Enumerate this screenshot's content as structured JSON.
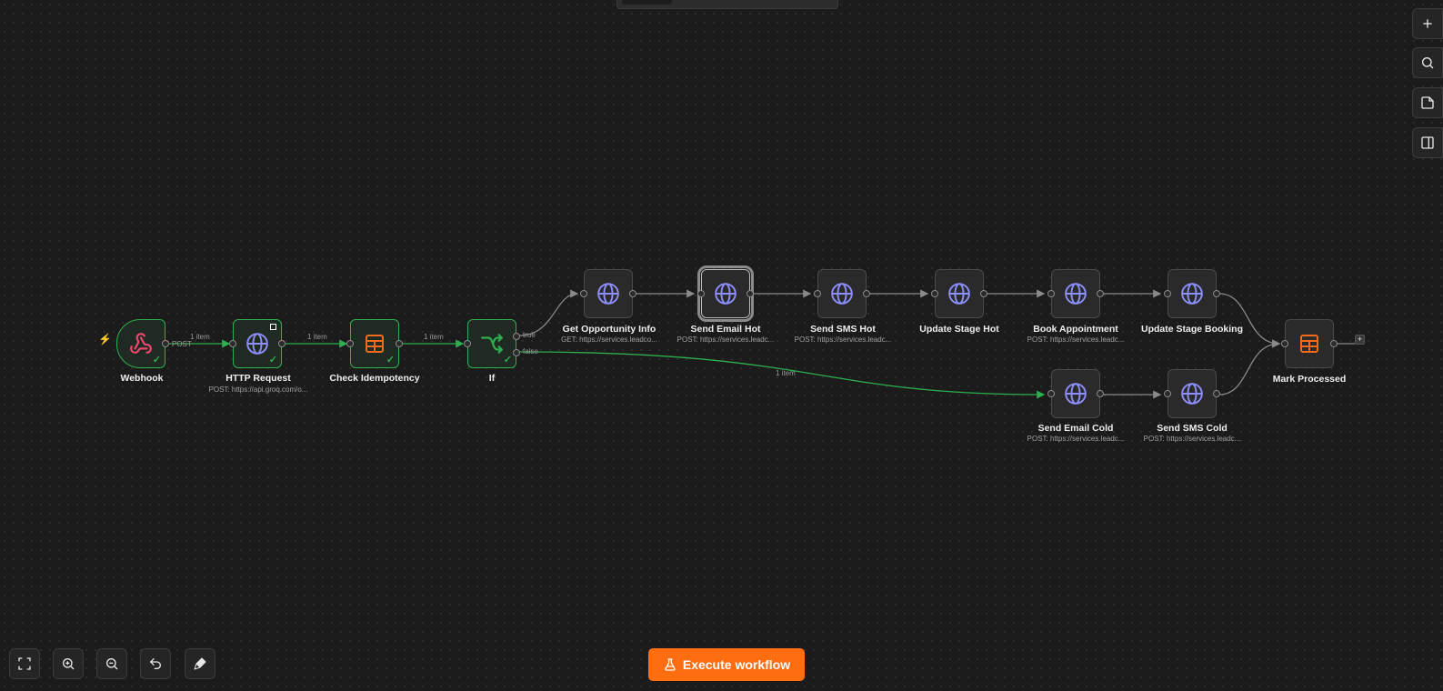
{
  "colors": {
    "canvas": "#1b1b1b",
    "node_bg": "#2a2a2a",
    "success_border": "#2eae4e",
    "http_icon": "#8d8dfb",
    "table_icon": "#f26b1d",
    "webhook_icon": "#ef476f",
    "accent": "#ff6d11"
  },
  "nodes": {
    "webhook": {
      "label": "Webhook",
      "icon": "webhook-icon"
    },
    "http_request": {
      "label": "HTTP Request",
      "subtitle": "POST: https://api.groq.com/o...",
      "icon": "globe-icon"
    },
    "check_idempotency": {
      "label": "Check Idempotency",
      "icon": "table-icon"
    },
    "if": {
      "label": "If",
      "icon": "branch-icon",
      "true_label": "true",
      "false_label": "false"
    },
    "get_opportunity": {
      "label": "Get Opportunity Info",
      "subtitle": "GET: https://services.leadco...",
      "icon": "globe-icon"
    },
    "send_email_hot": {
      "label": "Send Email Hot",
      "subtitle": "POST: https://services.leadc...",
      "icon": "globe-icon"
    },
    "send_sms_hot": {
      "label": "Send SMS Hot",
      "subtitle": "POST: https://services.leadc...",
      "icon": "globe-icon"
    },
    "update_stage_hot": {
      "label": "Update Stage Hot",
      "icon": "globe-icon"
    },
    "book_appointment": {
      "label": "Book Appointment",
      "subtitle": "POST: https://services.leadc...",
      "icon": "globe-icon"
    },
    "update_stage_booking": {
      "label": "Update Stage Booking",
      "icon": "globe-icon"
    },
    "send_email_cold": {
      "label": "Send Email Cold",
      "subtitle": "POST: https://services.leadc...",
      "icon": "globe-icon"
    },
    "send_sms_cold": {
      "label": "Send SMS Cold",
      "subtitle": "POST: https://services.leadc...",
      "icon": "globe-icon"
    },
    "mark_processed": {
      "label": "Mark Processed",
      "icon": "table-icon"
    }
  },
  "edges": {
    "webhook_method": "POST",
    "webhook_to_http": "1 item",
    "http_to_check": "1 item",
    "check_to_if": "1 item",
    "if_false_to_cold": "1 item"
  },
  "end_plus": "+",
  "toolbar_right": [
    "plus-icon",
    "search-icon",
    "sticky-note-icon",
    "panel-toggle-icon"
  ],
  "toolbar_bottom": [
    "fit-view-icon",
    "zoom-in-icon",
    "zoom-out-icon",
    "undo-icon",
    "clean-up-icon"
  ],
  "execute_button": {
    "label": "Execute workflow",
    "icon": "flask-icon"
  }
}
